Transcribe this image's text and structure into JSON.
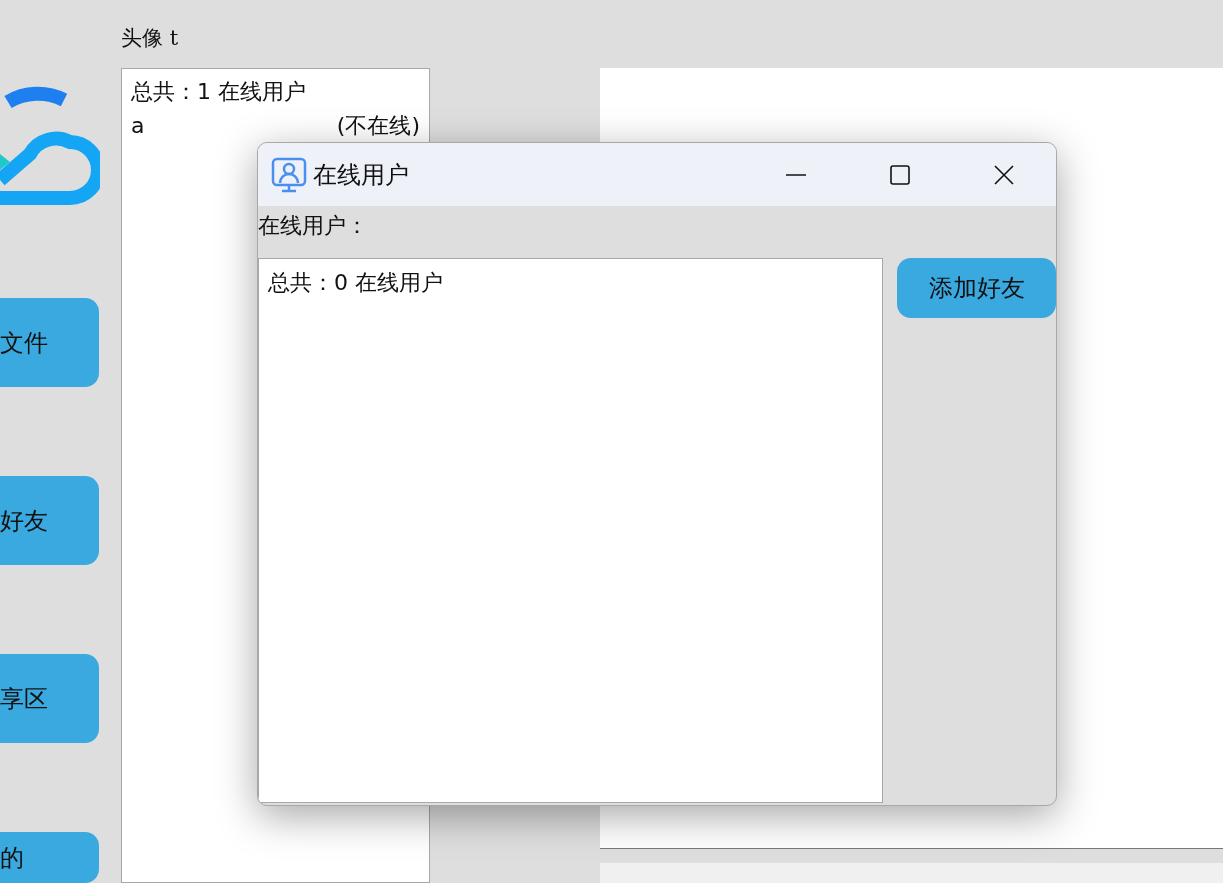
{
  "main_window": {
    "nav_buttons": [
      {
        "label": "文件"
      },
      {
        "label": "好友"
      },
      {
        "label": "享区"
      },
      {
        "label": "的"
      }
    ],
    "avatar_label": "头像 t",
    "user_list": {
      "summary": "总共：1 在线用户",
      "rows": [
        {
          "name": "a",
          "status": "(不在线)"
        }
      ]
    }
  },
  "dialog": {
    "title": "在线用户",
    "label": "在线用户：",
    "list": {
      "summary": "总共：0 在线用户"
    },
    "add_friend_button": "添加好友"
  }
}
